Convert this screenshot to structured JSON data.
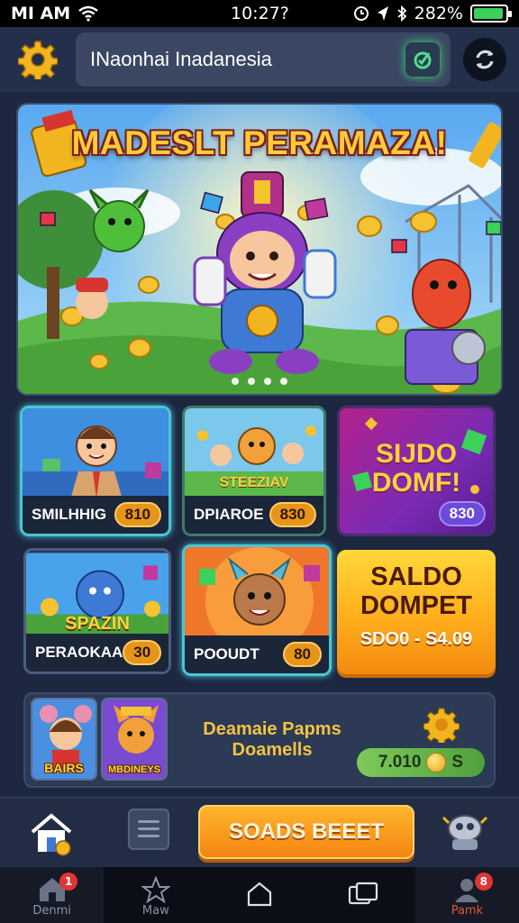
{
  "status_bar": {
    "carrier": "MI AM",
    "time": "10:27?",
    "battery_text": "282%",
    "battery_level": 0.95
  },
  "header": {
    "search_value": "INaonhai Inadanesia",
    "icons": [
      "gear-icon",
      "camera-check-icon",
      "refresh-icon"
    ]
  },
  "banner": {
    "title": "MADESLT PERAMAZA!",
    "slide_count": 4
  },
  "tiles": [
    {
      "name": "SMILHHIG",
      "value": "810",
      "pill": "orange"
    },
    {
      "name": "DPIAROE",
      "value": "830",
      "art_text": "STEEZIAV",
      "pill": "orange"
    },
    {
      "art_text_line1": "SIJDO",
      "art_text_line2": "DOMF!",
      "value": "830",
      "pill": "purple"
    },
    {
      "name": "PERAOKAA",
      "value": "30",
      "art_text": "SPAZIN",
      "pill": "orange"
    },
    {
      "name": "POOUDT",
      "value": "80",
      "pill": "orange"
    },
    {
      "line1": "SALDO",
      "line2": "DOMPET",
      "line3": "SDO0 - S4.09"
    }
  ],
  "wallet": {
    "thumb1_label": "BAIRS",
    "thumb2_label": "MBDINEYS",
    "title_line1": "Deamaie Papms",
    "title_line2": "Doamells",
    "balance": "7.010",
    "balance_suffix": "S"
  },
  "action_bar": {
    "cta_label": "SOADS BEEET"
  },
  "nav": [
    {
      "label": "Denmi",
      "icon": "home-icon",
      "badge": "1"
    },
    {
      "label": "Maw",
      "icon": "star-icon"
    },
    {
      "label": "",
      "icon": "home-outline-icon"
    },
    {
      "label": "",
      "icon": "recent-apps-icon"
    },
    {
      "label": "Pamk",
      "icon": "user-icon",
      "badge": "8"
    }
  ],
  "colors": {
    "background": "#1d2740",
    "accent_orange": "#f48412",
    "accent_yellow": "#ffcb38",
    "accent_green": "#3bd15a"
  }
}
